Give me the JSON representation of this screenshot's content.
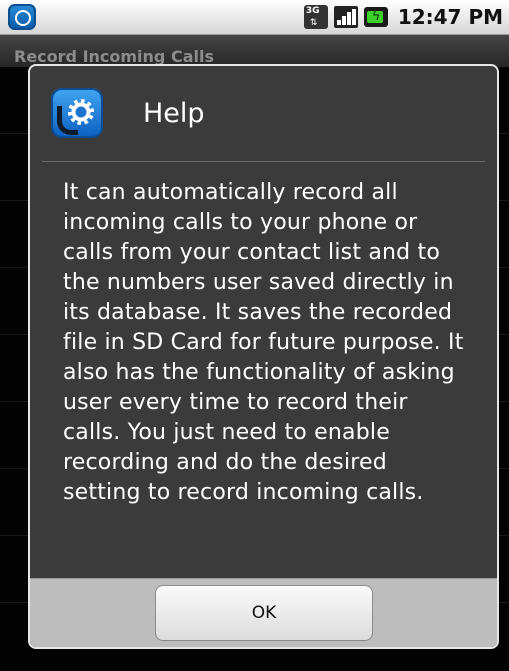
{
  "status_bar": {
    "time": "12:47 PM",
    "network_label": "3G",
    "icons": [
      "app-notification-icon",
      "3g-network-icon",
      "signal-strength-icon",
      "battery-charging-icon"
    ]
  },
  "app": {
    "title": "Record Incoming Calls"
  },
  "dialog": {
    "title": "Help",
    "icon": "call-recorder-gear-icon",
    "body": "It can automatically record all incoming calls to your phone or calls from your contact list and to the numbers user saved directly in its database. It saves the recorded file in SD Card for future purpose. It also has the functionality of asking user every time to record their calls. You just need to enable recording and do the desired setting to record incoming calls.",
    "ok_label": "OK"
  },
  "colors": {
    "dialog_bg": "#3b3b3b",
    "footer_bg": "#bdbdbd",
    "icon_blue": "#1d74cf",
    "battery_green": "#3ecf2a"
  }
}
